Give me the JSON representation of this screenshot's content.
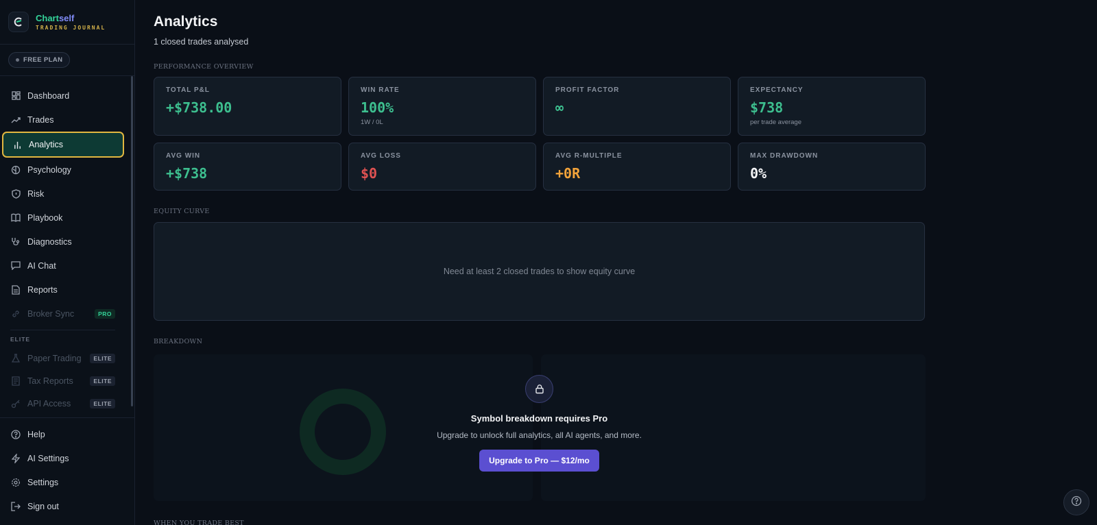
{
  "brand": {
    "name_part1": "Chart",
    "name_part2": "self",
    "subtitle": "TRADING JOURNAL"
  },
  "plan": {
    "label": "FREE PLAN"
  },
  "sidebar": {
    "items": [
      {
        "label": "Dashboard",
        "icon": "dashboard-icon"
      },
      {
        "label": "Trades",
        "icon": "trending-up-icon"
      },
      {
        "label": "Analytics",
        "icon": "bar-chart-icon",
        "active": true
      },
      {
        "label": "Psychology",
        "icon": "brain-icon"
      },
      {
        "label": "Risk",
        "icon": "shield-icon"
      },
      {
        "label": "Playbook",
        "icon": "book-icon"
      },
      {
        "label": "Diagnostics",
        "icon": "stethoscope-icon"
      },
      {
        "label": "AI Chat",
        "icon": "chat-icon"
      },
      {
        "label": "Reports",
        "icon": "file-icon"
      },
      {
        "label": "Broker Sync",
        "icon": "link-icon",
        "tag": "PRO",
        "disabled": true
      }
    ],
    "elite_label": "ELITE",
    "elite_items": [
      {
        "label": "Paper Trading",
        "icon": "flask-icon",
        "tag": "ELITE"
      },
      {
        "label": "Tax Reports",
        "icon": "receipt-icon",
        "tag": "ELITE"
      },
      {
        "label": "API Access",
        "icon": "key-icon",
        "tag": "ELITE"
      }
    ],
    "bottom_items": [
      {
        "label": "Help",
        "icon": "help-circle-icon"
      },
      {
        "label": "AI Settings",
        "icon": "zap-icon"
      },
      {
        "label": "Settings",
        "icon": "gear-icon"
      },
      {
        "label": "Sign out",
        "icon": "logout-icon"
      }
    ]
  },
  "page": {
    "title": "Analytics",
    "subtitle": "1 closed trades analysed"
  },
  "performance": {
    "heading": "PERFORMANCE OVERVIEW",
    "cards": [
      {
        "label": "TOTAL P&L",
        "value": "+$738.00",
        "color": "#3dbf8f"
      },
      {
        "label": "WIN RATE",
        "value": "100%",
        "note": "1W / 0L",
        "color": "#3dbf8f"
      },
      {
        "label": "PROFIT FACTOR",
        "value": "∞",
        "color": "#3dbf8f"
      },
      {
        "label": "EXPECTANCY",
        "value": "$738",
        "note": "per trade average",
        "color": "#3dbf8f"
      },
      {
        "label": "AVG WIN",
        "value": "+$738",
        "color": "#3dbf8f"
      },
      {
        "label": "AVG LOSS",
        "value": "$0",
        "color": "#e05252"
      },
      {
        "label": "AVG R-MULTIPLE",
        "value": "+0R",
        "color": "#f2a33a"
      },
      {
        "label": "MAX DRAWDOWN",
        "value": "0%",
        "color": "#f3f4f6"
      }
    ]
  },
  "equity": {
    "heading": "EQUITY CURVE",
    "empty_message": "Need at least 2 closed trades to show equity curve"
  },
  "breakdown": {
    "heading": "BREAKDOWN",
    "lock_title": "Symbol breakdown requires Pro",
    "lock_desc": "Upgrade to unlock full analytics, all AI agents, and more.",
    "upgrade_label": "Upgrade to Pro — $12/mo"
  },
  "next_section": {
    "heading": "WHEN YOU TRADE BEST"
  }
}
